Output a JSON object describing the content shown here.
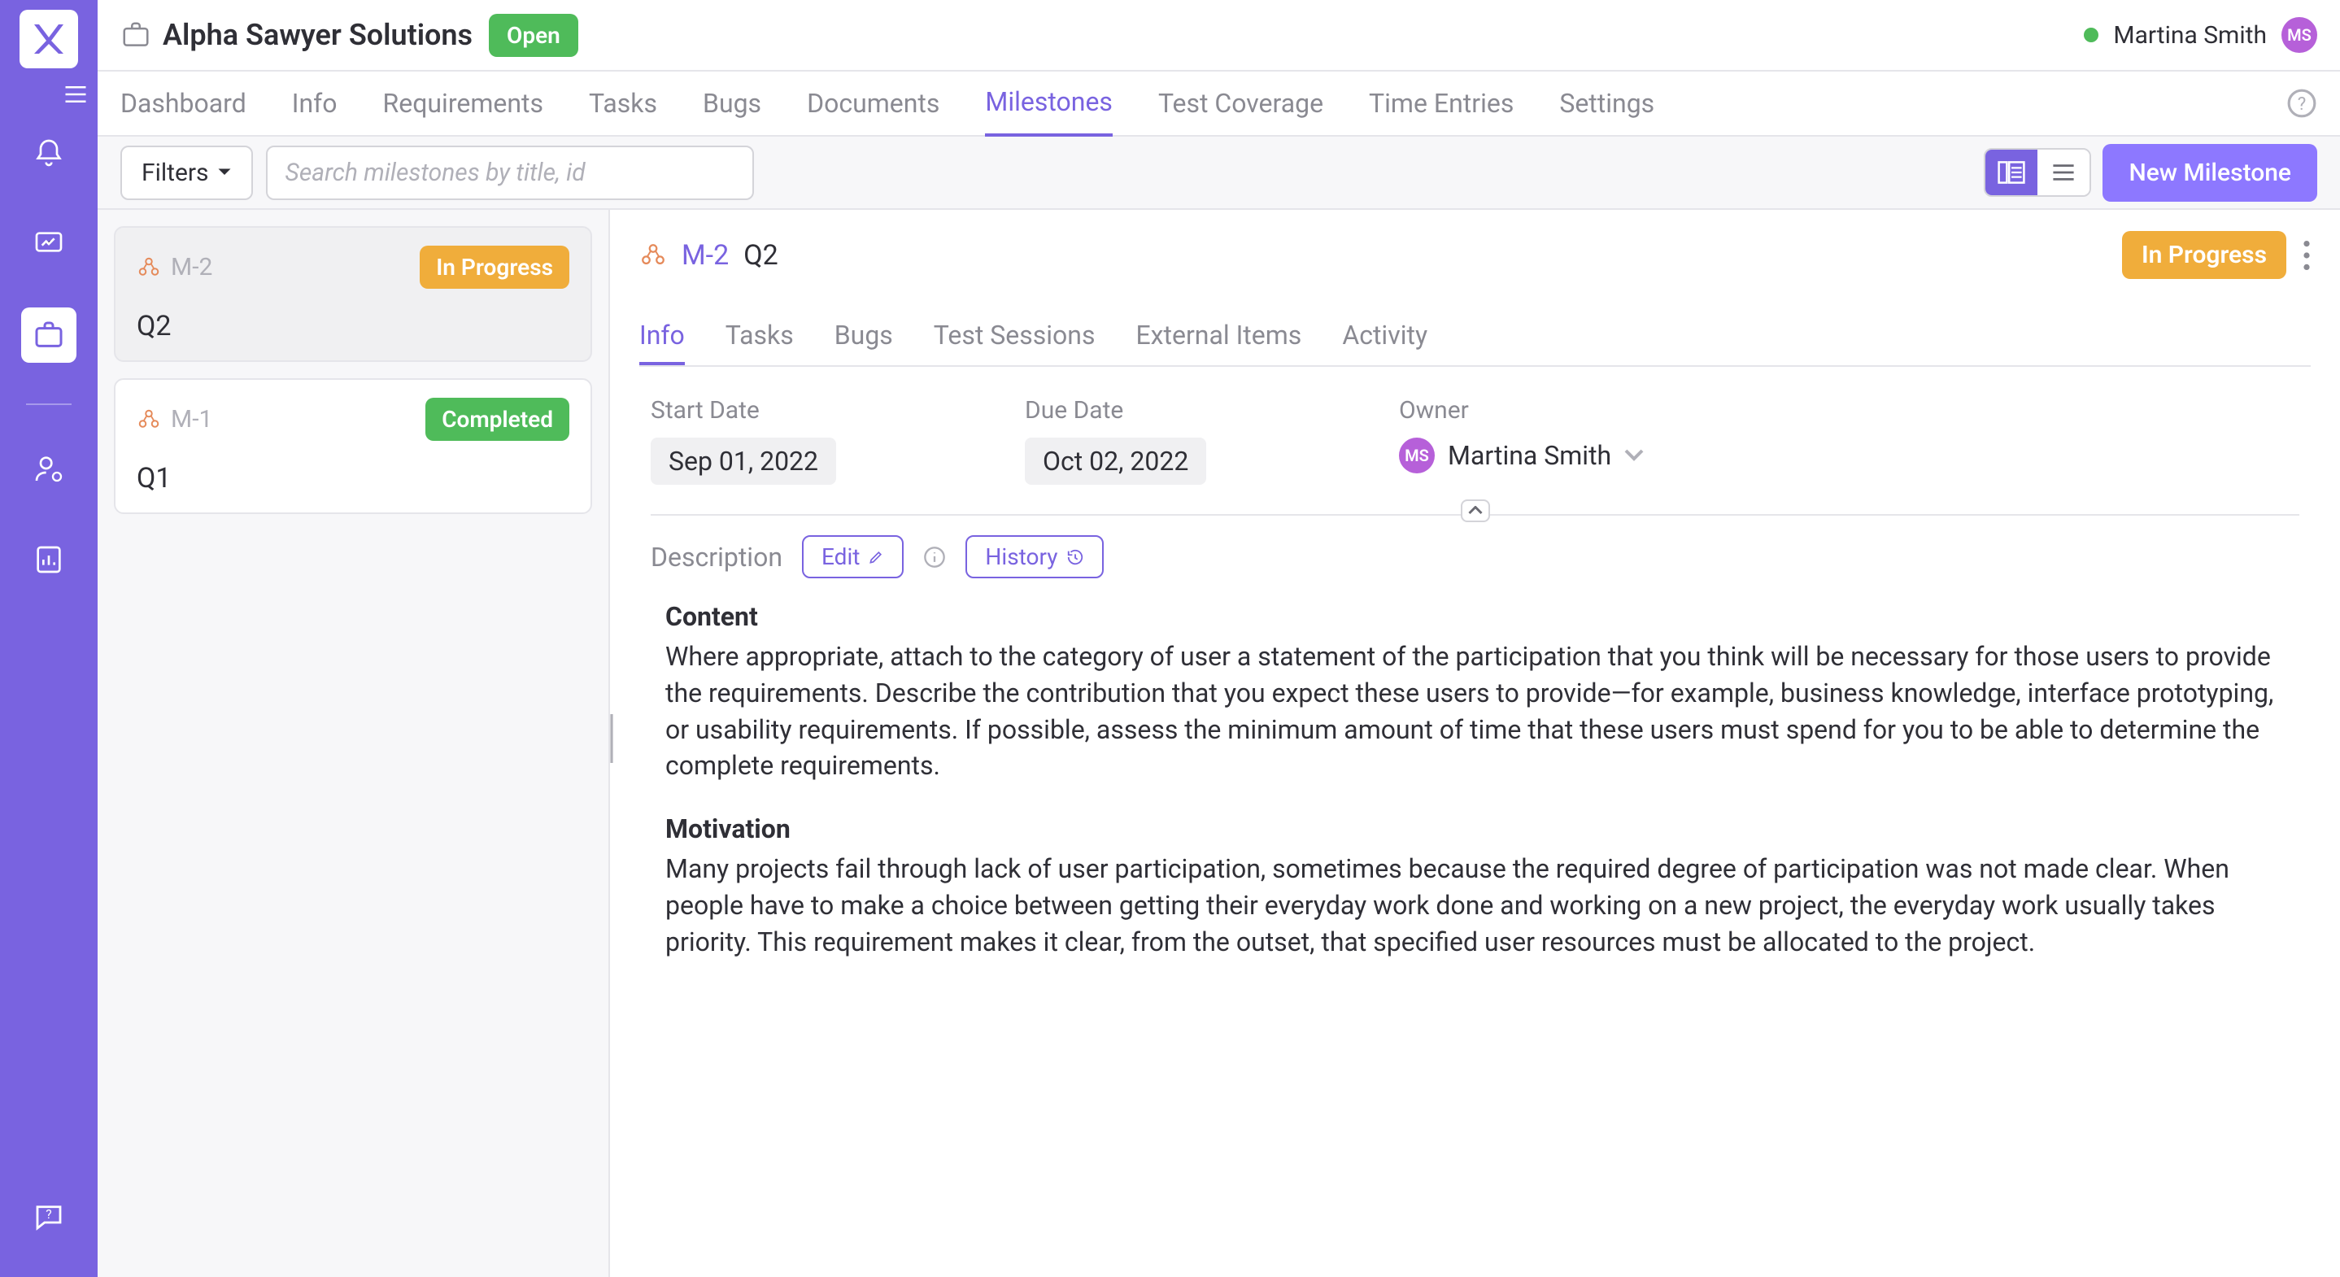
{
  "workspace": {
    "name": "Alpha Sawyer Solutions",
    "status": "Open"
  },
  "current_user": {
    "name": "Martina Smith",
    "initials": "MS"
  },
  "nav": {
    "tabs": [
      "Dashboard",
      "Info",
      "Requirements",
      "Tasks",
      "Bugs",
      "Documents",
      "Milestones",
      "Test Coverage",
      "Time Entries",
      "Settings"
    ],
    "active_index": 6
  },
  "toolbar": {
    "filters_label": "Filters",
    "search_placeholder": "Search milestones by title, id",
    "new_button": "New Milestone"
  },
  "milestones": [
    {
      "id": "M-2",
      "title": "Q2",
      "status_label": "In Progress",
      "status_kind": "progress",
      "selected": true
    },
    {
      "id": "M-1",
      "title": "Q1",
      "status_label": "Completed",
      "status_kind": "completed",
      "selected": false
    }
  ],
  "detail": {
    "id": "M-2",
    "title": "Q2",
    "status_label": "In Progress",
    "tabs": [
      "Info",
      "Tasks",
      "Bugs",
      "Test Sessions",
      "External Items",
      "Activity"
    ],
    "active_tab_index": 0,
    "fields": {
      "start_date": {
        "label": "Start Date",
        "value": "Sep 01, 2022"
      },
      "due_date": {
        "label": "Due Date",
        "value": "Oct 02, 2022"
      },
      "owner": {
        "label": "Owner",
        "value": "Martina Smith",
        "initials": "MS"
      }
    },
    "description": {
      "label": "Description",
      "edit_label": "Edit",
      "history_label": "History",
      "sections": [
        {
          "heading": "Content",
          "body": "Where appropriate, attach to the category of user a statement of the participation that you think will be necessary for those users to provide the requirements. Describe the contribution that you expect these users to provide—for example, business knowledge, interface prototyping, or usability requirements. If possible, assess the minimum amount of time that these users must spend for you to be able to determine the complete requirements."
        },
        {
          "heading": "Motivation",
          "body": "Many projects fail through lack of user participation, sometimes because the required degree of participation was not made clear. When people have to make a choice between getting their everyday work done and working on a new project, the everyday work usually takes priority. This requirement makes it clear, from the outset, that specified user resources must be allocated to the project."
        }
      ]
    }
  }
}
